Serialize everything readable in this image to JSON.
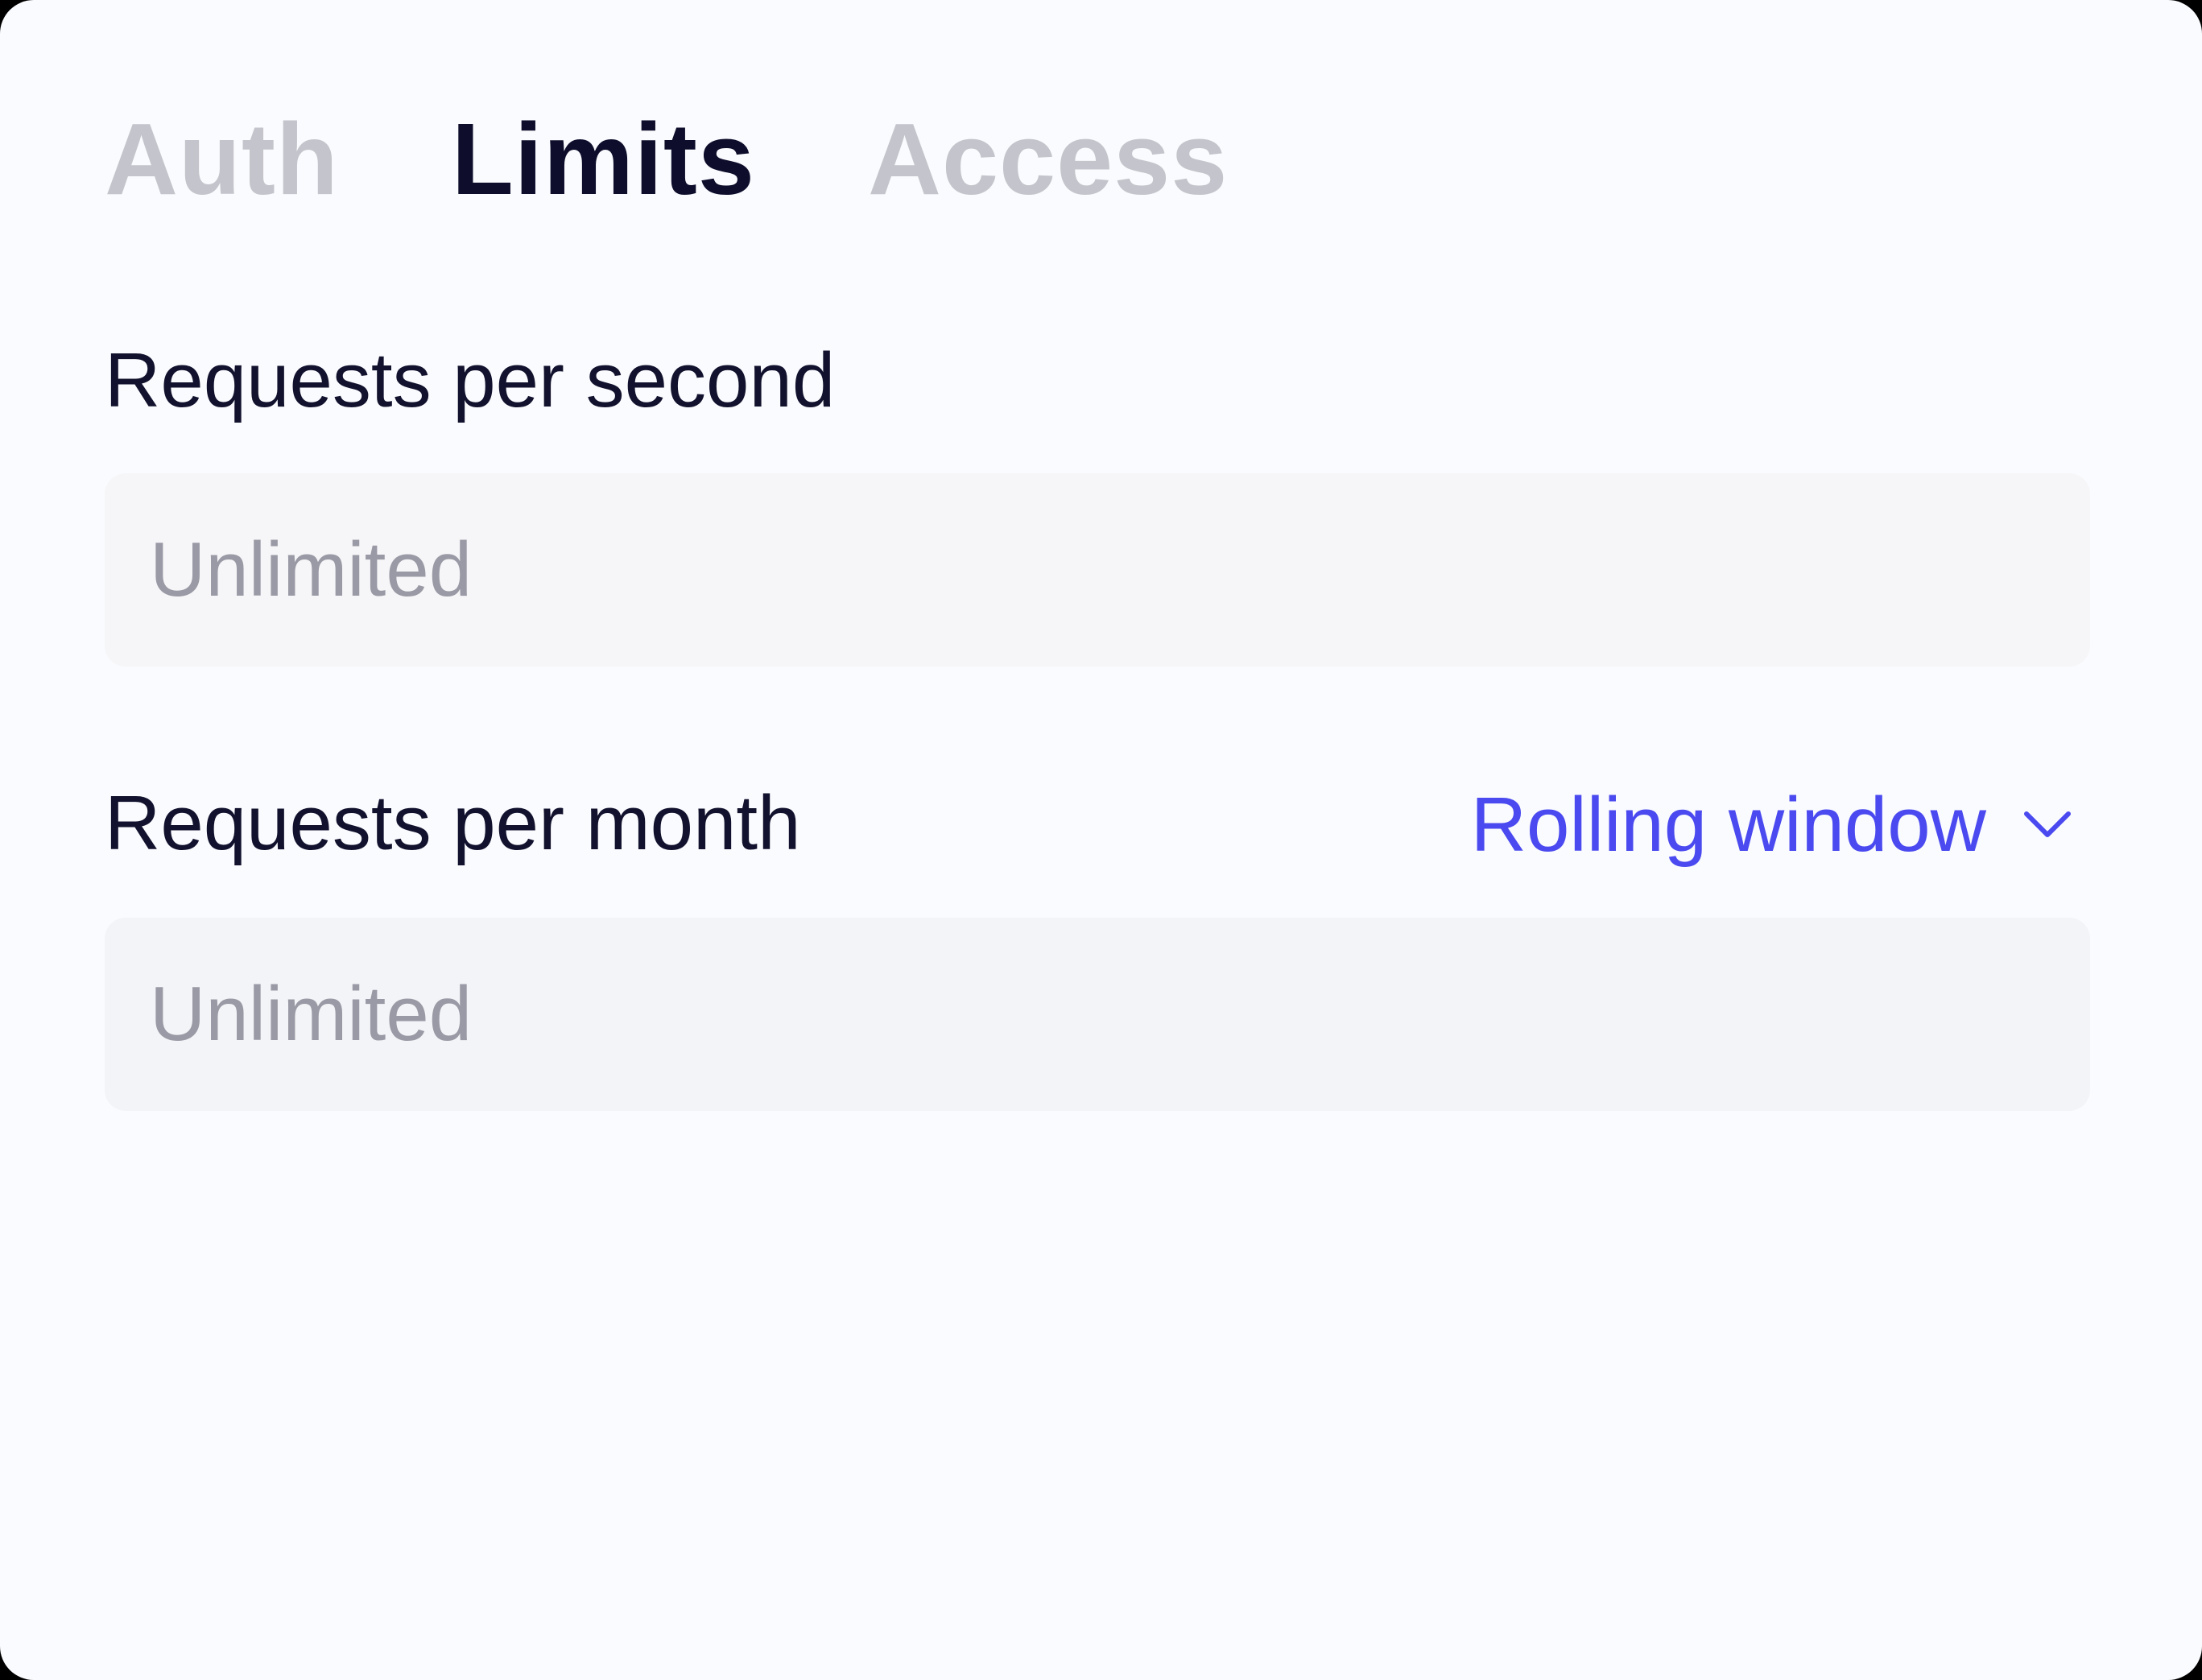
{
  "tabs": [
    {
      "label": "Auth",
      "active": false
    },
    {
      "label": "Limits",
      "active": true
    },
    {
      "label": "Access",
      "active": false
    }
  ],
  "requests_per_second": {
    "label": "Requests per second",
    "value": "",
    "placeholder": "Unlimited"
  },
  "requests_per_month": {
    "label": "Requests per month",
    "value": "",
    "placeholder": "Unlimited",
    "window_select": {
      "selected": "Rolling window",
      "icon": "chevron-down-icon"
    }
  },
  "colors": {
    "background": "#fafbfe",
    "active_tab": "#0e0e2c",
    "inactive_tab": "#c4c4cc",
    "accent": "#4a4af0",
    "placeholder": "#9a9aa6",
    "input_fill": "#f3f4f7"
  }
}
